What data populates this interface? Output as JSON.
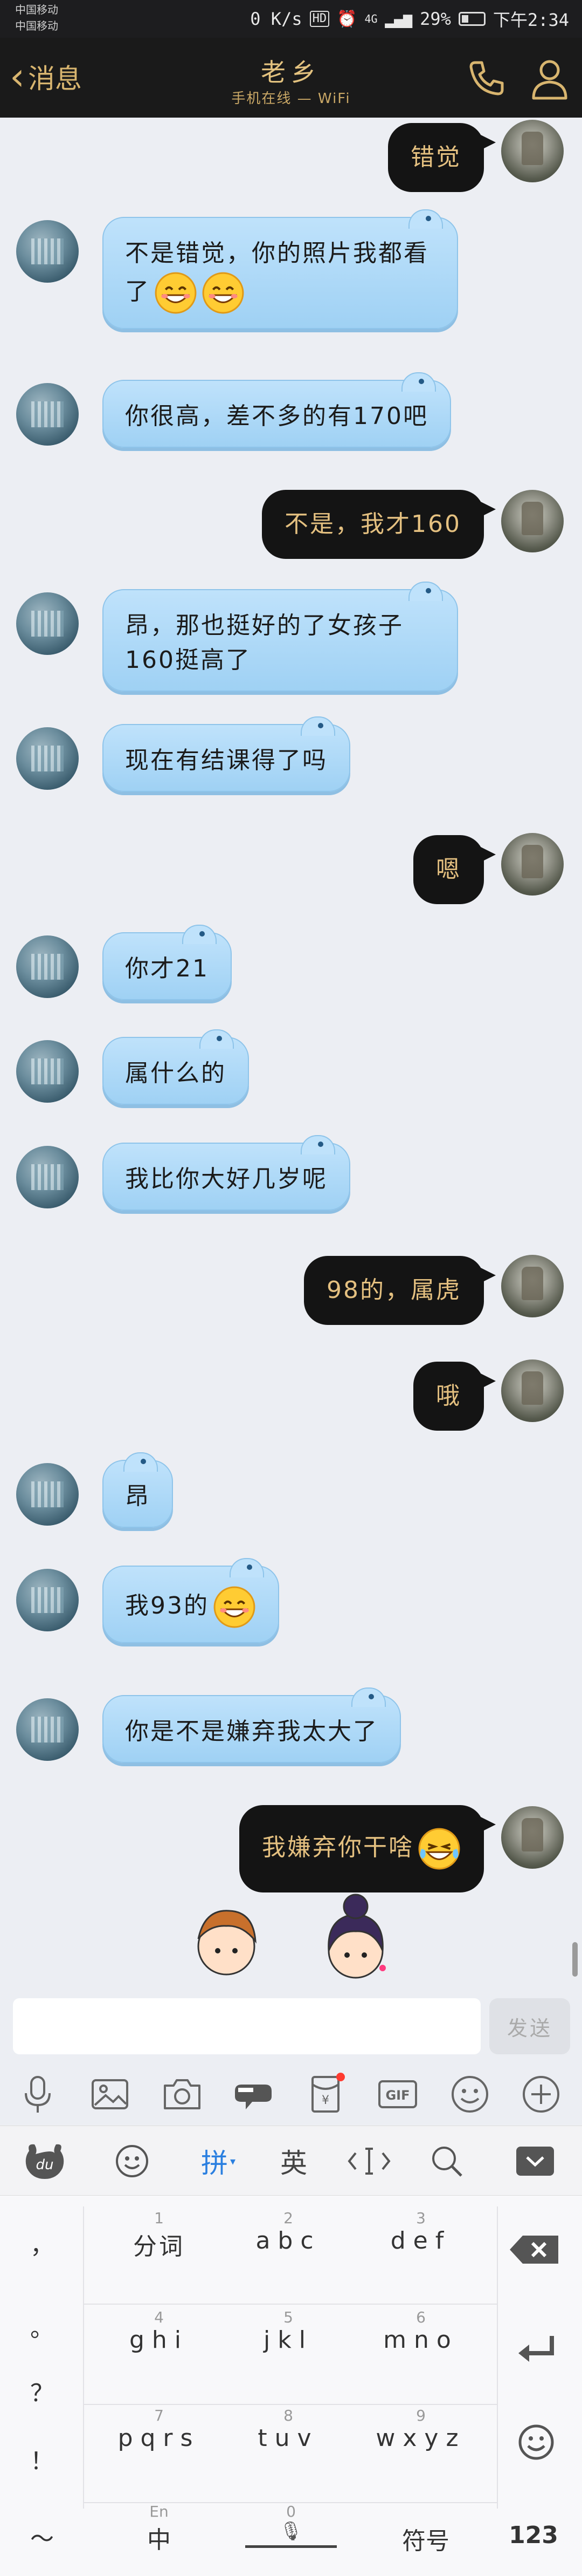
{
  "status_bar": {
    "carrier_1": "中国移动",
    "carrier_2": "中国移动",
    "net_speed": "0 K/s",
    "hd_badge": "HD",
    "signal_label": "4G",
    "battery": "29%",
    "time": "下午2:34"
  },
  "title_bar": {
    "back_label": "消息",
    "contact_name": "老乡",
    "contact_status": "手机在线 — WiFi",
    "icons": [
      "phone-icon",
      "profile-icon"
    ]
  },
  "messages": [
    {
      "sender": "me",
      "text": "错觉"
    },
    {
      "sender": "peer",
      "text": "不是错觉，你的照片我都看\n了",
      "emoji": [
        "grin-emoji",
        "grin-emoji"
      ]
    },
    {
      "sender": "peer",
      "text": "你很高，差不多的有170吧"
    },
    {
      "sender": "me",
      "text": "不是，我才160"
    },
    {
      "sender": "peer",
      "text": "昂，那也挺好的了女孩子\n160挺高了"
    },
    {
      "sender": "peer",
      "text": "现在有结课得了吗"
    },
    {
      "sender": "me",
      "text": "嗯"
    },
    {
      "sender": "peer",
      "text": "你才21"
    },
    {
      "sender": "peer",
      "text": "属什么的"
    },
    {
      "sender": "peer",
      "text": "我比你大好几岁呢"
    },
    {
      "sender": "me",
      "text": "98的，属虎"
    },
    {
      "sender": "me",
      "text": "哦"
    },
    {
      "sender": "peer",
      "text": "昂"
    },
    {
      "sender": "peer",
      "text": "我93的",
      "emoji": [
        "grin-emoji"
      ]
    },
    {
      "sender": "peer",
      "text": "你是不是嫌弃我太大了"
    },
    {
      "sender": "me",
      "text": "我嫌弃你干啥",
      "emoji": [
        "laugh-tears-emoji"
      ]
    }
  ],
  "input": {
    "placeholder": "",
    "send_label": "发送"
  },
  "toolbar_icons": [
    "microphone-icon",
    "picture-icon",
    "camera-icon",
    "hongbao-icon",
    "red-packet-icon",
    "gif-icon",
    "smiley-icon",
    "plus-icon"
  ],
  "keyboard_toolbar": {
    "brand_icon": "du-logo-icon",
    "pinyin_label": "拼",
    "english_label": "英",
    "icons": [
      "emoji-face-icon",
      "cursor-icon",
      "search-icon",
      "hide-keyboard-icon"
    ]
  },
  "keyboard": {
    "punctuation": [
      "，",
      "。",
      "？",
      "！",
      "～"
    ],
    "keys": [
      {
        "num": "1",
        "label": "分词"
      },
      {
        "num": "2",
        "label": "abc"
      },
      {
        "num": "3",
        "label": "def"
      },
      {
        "num": "4",
        "label": "ghi"
      },
      {
        "num": "5",
        "label": "jkl"
      },
      {
        "num": "6",
        "label": "mno"
      },
      {
        "num": "7",
        "label": "pqrs"
      },
      {
        "num": "8",
        "label": "tuv"
      },
      {
        "num": "9",
        "label": "wxyz"
      }
    ],
    "bottom_row": {
      "lang_sup": "En",
      "lang_label": "中",
      "space_num": "0",
      "symbols_label": "符号",
      "numbers_label": "123"
    }
  },
  "colors": {
    "dark_bar": "#1a1a1a",
    "gold_text": "#e3c27f",
    "peer_bubble": "#bfe2fb",
    "me_bubble": "#141414",
    "chat_bg": "#eceef3"
  }
}
